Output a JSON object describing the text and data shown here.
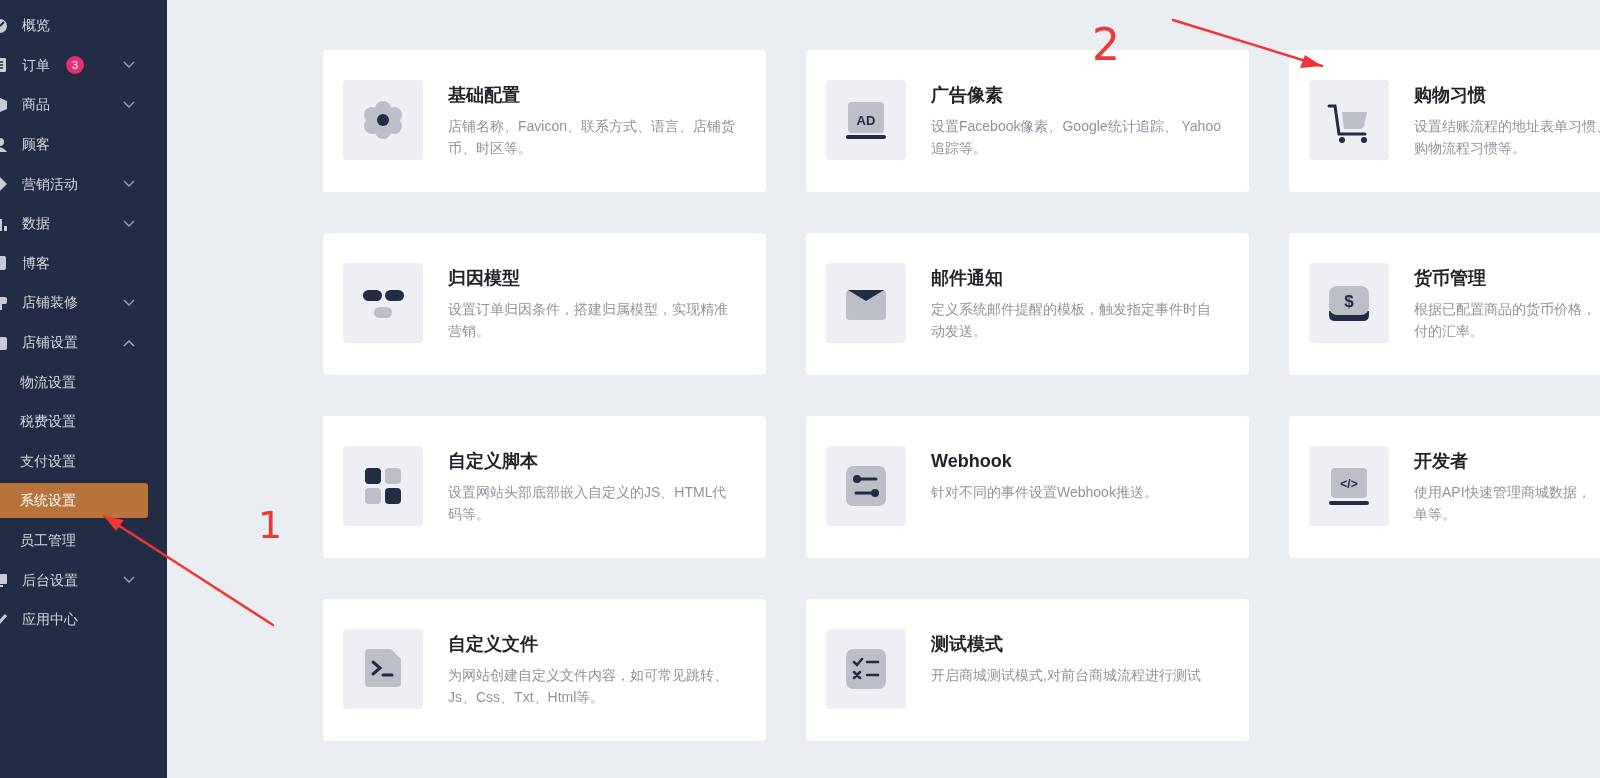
{
  "sidebar": {
    "items": [
      {
        "label": "概览"
      },
      {
        "label": "订单",
        "badge": "3",
        "expanded": false
      },
      {
        "label": "商品",
        "expanded": false
      },
      {
        "label": "顾客"
      },
      {
        "label": "营销活动",
        "expanded": false
      },
      {
        "label": "数据",
        "expanded": false
      },
      {
        "label": "博客"
      },
      {
        "label": "店铺装修",
        "expanded": false
      },
      {
        "label": "店铺设置",
        "expanded": true,
        "children": [
          {
            "label": "物流设置",
            "selected": false
          },
          {
            "label": "税费设置",
            "selected": false
          },
          {
            "label": "支付设置",
            "selected": false
          },
          {
            "label": "系统设置",
            "selected": true
          },
          {
            "label": "员工管理",
            "selected": false
          }
        ]
      },
      {
        "label": "后台设置",
        "expanded": false
      },
      {
        "label": "应用中心"
      }
    ]
  },
  "settings_cards": [
    {
      "kind": "gear",
      "title": "基础配置",
      "description": [
        "店铺名称、Favicon、联系方式、语言、店铺货币、时区等。"
      ]
    },
    {
      "kind": "ad",
      "icon_text": "AD",
      "title": "广告像素",
      "description": [
        "设置Facebook像素、Google统计追踪、 Yahoo追踪等。"
      ]
    },
    {
      "kind": "cart",
      "title": "购物习惯",
      "description": [
        "设置结账流程的地址表单习惯、",
        "购物流程习惯等。"
      ]
    },
    {
      "kind": "glasses",
      "title": "归因模型",
      "description": [
        "设置订单归因条件，搭建归属模型，实现精准营销。"
      ]
    },
    {
      "kind": "mail",
      "title": "邮件通知",
      "description": [
        "定义系统邮件提醒的模板，触发指定事件时自动发送。"
      ]
    },
    {
      "kind": "money",
      "icon_text": "$",
      "title": "货币管理",
      "description": [
        "根据已配置商品的货币价格，",
        "付的汇率。"
      ]
    },
    {
      "kind": "grid",
      "title": "自定义脚本",
      "description": [
        "设置网站头部底部嵌入自定义的JS、HTML代码等。"
      ]
    },
    {
      "kind": "sliders",
      "title": "Webhook",
      "description": [
        "针对不同的事件设置Webhook推送。"
      ]
    },
    {
      "kind": "code",
      "icon_text": "</>",
      "title": "开发者",
      "description": [
        "使用API快速管理商城数据，",
        "单等。"
      ]
    },
    {
      "kind": "terminal",
      "title": "自定义文件",
      "description": [
        "为网站创建自定义文件内容，如可常见跳转、Js、Css、Txt、Html等。"
      ]
    },
    {
      "kind": "checklist",
      "title": "测试模式",
      "description": [
        "开启商城测试模式,对前台商城流程进行测试"
      ]
    }
  ],
  "annotations": [
    {
      "label": "1"
    },
    {
      "label": "2"
    }
  ]
}
